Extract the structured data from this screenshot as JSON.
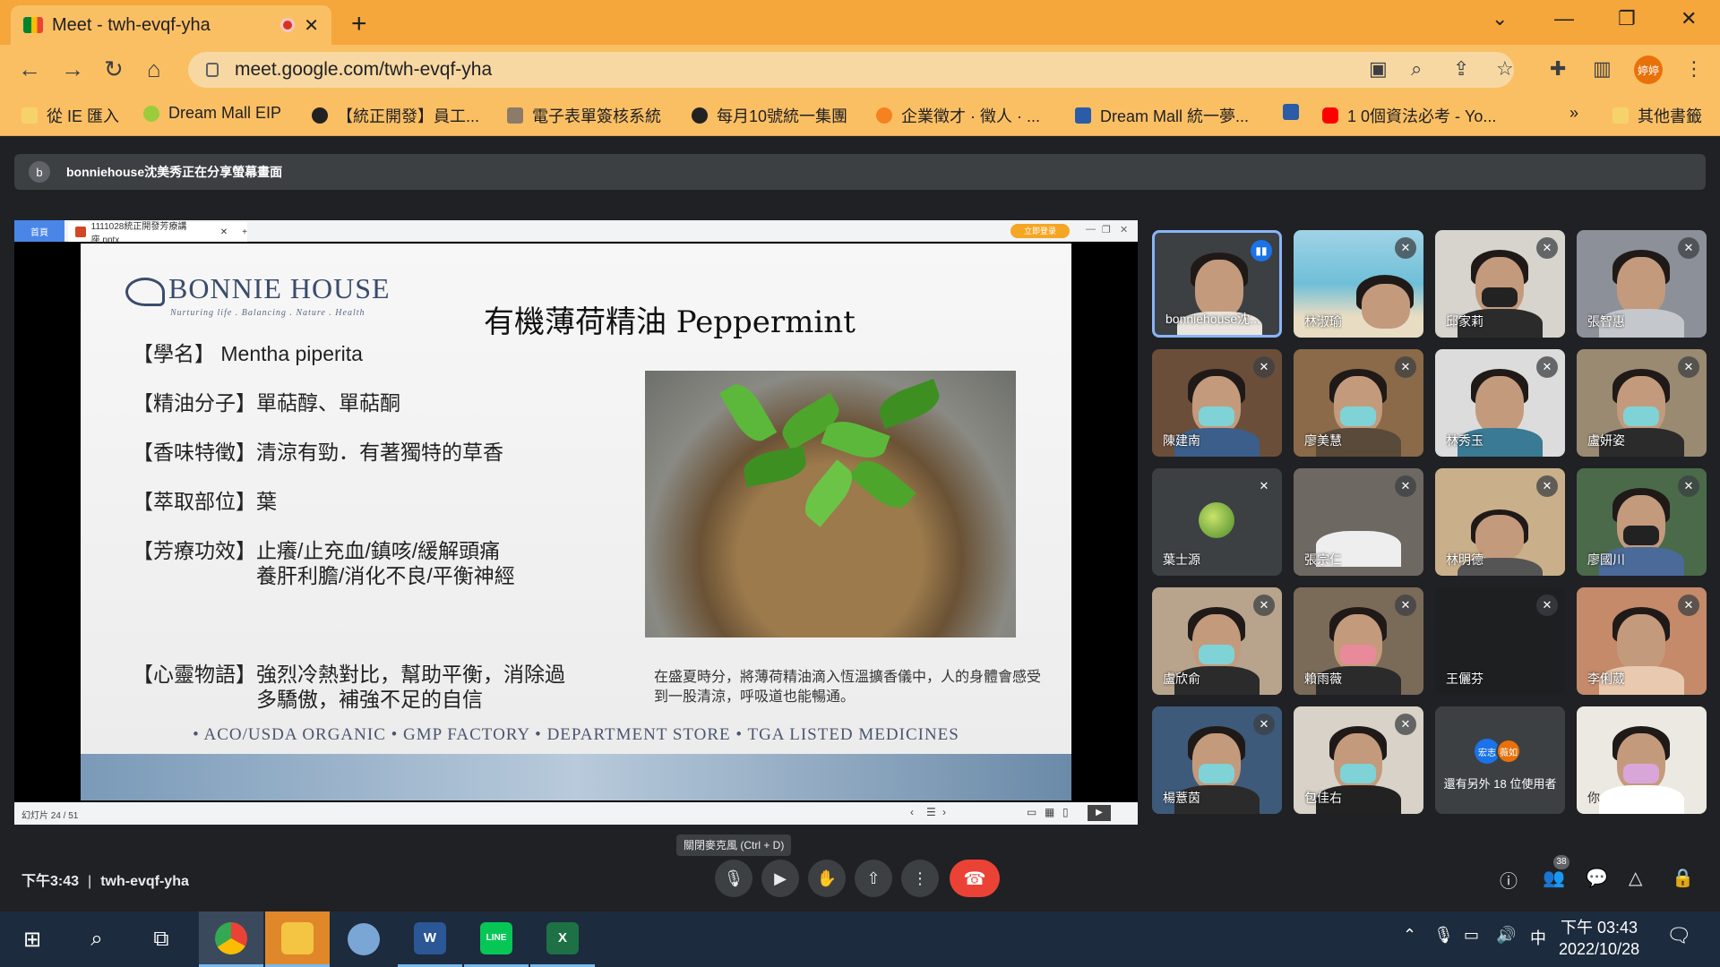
{
  "browser": {
    "tab_title": "Meet - twh-evqf-yha",
    "url": "meet.google.com/twh-evqf-yha",
    "profile_label": "婷婷",
    "bookmarks": [
      "從 IE 匯入",
      "Dream Mall EIP",
      "【統正開發】員工...",
      "電子表單簽核系統",
      "每月10號統一集團",
      "企業徵才 · 徵人 · ...",
      "Dream Mall 統一夢...",
      "",
      "1 0個資法必考 - Yo..."
    ],
    "bookmarks_more": "»",
    "other_bookmarks": "其他書籤"
  },
  "share_banner": {
    "avatar_letter": "b",
    "text": "bonniehouse沈美秀正在分享螢幕畫面"
  },
  "presentation": {
    "home_tab": "首頁",
    "file_tab": "1111028統正開發芳療講座.pptx",
    "login_button": "立即登录",
    "status": "幻灯片 24 / 51",
    "slide": {
      "logo": "BONNIE HOUSE",
      "logo_tagline": "Nurturing life . Balancing . Nature . Health",
      "title": "有機薄荷精油 Peppermint",
      "bullets": [
        "【學名】 Mentha piperita",
        "【精油分子】單萜醇、單萜酮",
        "【香味特徵】清涼有勁．有著獨特的草香",
        "【萃取部位】葉",
        "【芳療功效】止癢/止充血/鎮咳/緩解頭痛",
        "　　　　　　養肝利膽/消化不良/平衡神經",
        "【心靈物語】強烈冷熱對比，幫助平衡，消除過",
        "　　　　　　多驕傲，補強不足的自信"
      ],
      "caption": "在盛夏時分，將薄荷精油滴入恆溫擴香儀中，人的身體會感受到一股清涼，呼吸道也能暢通。",
      "footer": "• ACO/USDA ORGANIC  • GMP FACTORY  •  DEPARTMENT STORE  •  TGA LISTED MEDICINES"
    }
  },
  "participants": [
    {
      "name": "bonniehouse沈...",
      "state": "speaking"
    },
    {
      "name": "林淑瑜",
      "state": "muted"
    },
    {
      "name": "邱家莉",
      "state": "muted"
    },
    {
      "name": "張智惠",
      "state": "muted"
    },
    {
      "name": "陳建南",
      "state": "muted"
    },
    {
      "name": "廖美慧",
      "state": "muted"
    },
    {
      "name": "林秀玉",
      "state": "muted"
    },
    {
      "name": "盧妍姿",
      "state": "muted"
    },
    {
      "name": "葉士源",
      "state": "muted"
    },
    {
      "name": "張宗仁",
      "state": "muted"
    },
    {
      "name": "林明德",
      "state": "muted"
    },
    {
      "name": "廖國川",
      "state": "muted"
    },
    {
      "name": "盧欣俞",
      "state": "muted"
    },
    {
      "name": "賴雨薇",
      "state": "muted"
    },
    {
      "name": "王儷芬",
      "state": "muted"
    },
    {
      "name": "李俐葳",
      "state": "muted"
    },
    {
      "name": "楊薏茵",
      "state": "muted"
    },
    {
      "name": "包佳右",
      "state": "muted"
    },
    {
      "name": "還有另外 18 位使用者",
      "state": "others",
      "avatars": [
        "宏志",
        "薇如"
      ]
    },
    {
      "name": "你",
      "state": "self"
    }
  ],
  "tooltip": "關閉麥克風 (Ctrl + D)",
  "meeting": {
    "time": "下午3:43",
    "code": "twh-evqf-yha",
    "participant_count": "38"
  },
  "taskbar": {
    "time": "下午 03:43",
    "date": "2022/10/28",
    "ime": "中",
    "notifications": "1"
  },
  "colors": {
    "chrome_tab_strip": "#f5a73b",
    "chrome_toolbar": "#fbbf63",
    "meet_bg": "#202124",
    "end_call": "#ea4335",
    "speaking": "#1a73e8"
  }
}
